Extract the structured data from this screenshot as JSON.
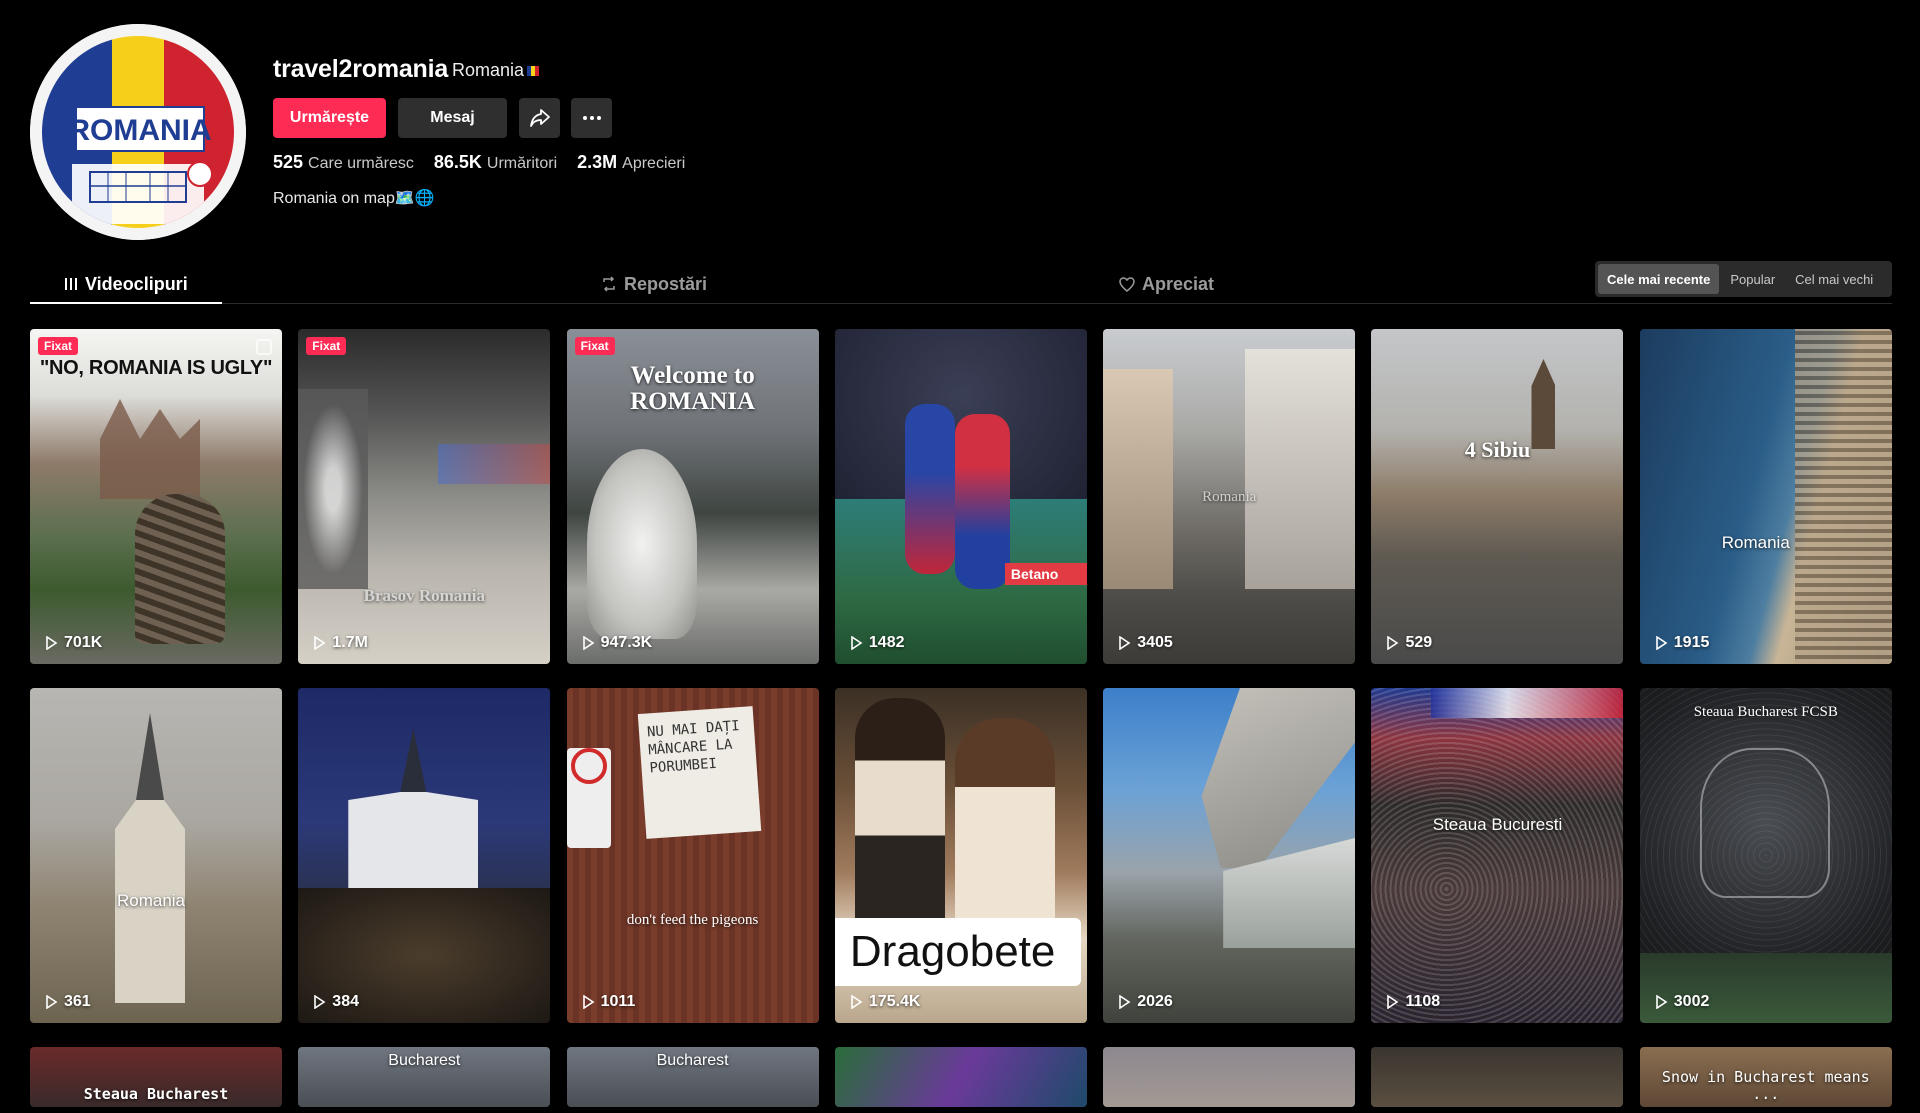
{
  "profile": {
    "avatar_text": "ROMANIA",
    "username": "travel2romania",
    "nickname": "Romania",
    "follow_label": "Urmărește",
    "message_label": "Mesaj",
    "share_icon": "share-icon",
    "more_icon": "more-icon",
    "stats": [
      {
        "value": "525",
        "label": "Care urmăresc"
      },
      {
        "value": "86.5K",
        "label": "Urmăritori"
      },
      {
        "value": "2.3M",
        "label": "Aprecieri"
      }
    ],
    "bio": "Romania on map🗺️🌐"
  },
  "tabs": [
    {
      "label": "Videoclipuri",
      "icon": "grid-icon",
      "active": true
    },
    {
      "label": "Repostări",
      "icon": "repost-icon",
      "active": false
    },
    {
      "label": "Apreciat",
      "icon": "heart-icon",
      "active": false
    }
  ],
  "sort": [
    {
      "label": "Cele mai recente",
      "active": true
    },
    {
      "label": "Popular",
      "active": false
    },
    {
      "label": "Cel mai vechi",
      "active": false
    }
  ],
  "pinned_label": "Fixat",
  "videos": [
    {
      "views": "701K",
      "pinned": true,
      "caption": "\"NO, ROMANIA IS UGLY\""
    },
    {
      "views": "1.7M",
      "pinned": true,
      "caption": "Brasov Romania"
    },
    {
      "views": "947.3K",
      "pinned": true,
      "caption": "Welcome to ROMANIA"
    },
    {
      "views": "1482",
      "pinned": false,
      "caption": ""
    },
    {
      "views": "3405",
      "pinned": false,
      "caption": "Romania"
    },
    {
      "views": "529",
      "pinned": false,
      "caption": "4 Sibiu"
    },
    {
      "views": "1915",
      "pinned": false,
      "caption": "Romania"
    },
    {
      "views": "361",
      "pinned": false,
      "caption": "Romania"
    },
    {
      "views": "384",
      "pinned": false,
      "caption": ""
    },
    {
      "views": "1011",
      "pinned": false,
      "caption": "don't feed the pigeons",
      "sign": "NU MAI DAȚI MÂNCARE LA PORUMBEI"
    },
    {
      "views": "175.4K",
      "pinned": false,
      "caption": "Dragobete"
    },
    {
      "views": "2026",
      "pinned": false,
      "caption": ""
    },
    {
      "views": "1108",
      "pinned": false,
      "caption": "Steaua Bucuresti"
    },
    {
      "views": "3002",
      "pinned": false,
      "caption": "Steaua Bucharest FCSB"
    },
    {
      "views": "",
      "pinned": false,
      "caption": "Steaua Bucharest"
    },
    {
      "views": "",
      "pinned": false,
      "caption": "Bucharest"
    },
    {
      "views": "",
      "pinned": false,
      "caption": "Bucharest"
    },
    {
      "views": "",
      "pinned": false,
      "caption": ""
    },
    {
      "views": "",
      "pinned": false,
      "caption": ""
    },
    {
      "views": "",
      "pinned": false,
      "caption": ""
    },
    {
      "views": "",
      "pinned": false,
      "caption": "Snow in Bucharest means ..."
    }
  ]
}
